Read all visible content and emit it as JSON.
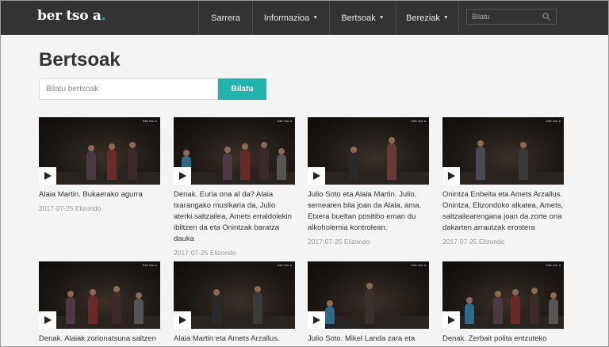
{
  "brand": {
    "logo_main": "ber tso a",
    "logo_dot": ".",
    "accent": "#1fb5ad"
  },
  "nav": {
    "items": [
      {
        "label": "Sarrera",
        "dropdown": false
      },
      {
        "label": "Informazioa",
        "dropdown": true
      },
      {
        "label": "Bertsoak",
        "dropdown": true
      },
      {
        "label": "Bereziak",
        "dropdown": true
      }
    ],
    "search_placeholder": "Bilatu",
    "search_icon": "search-icon",
    "caret_icon": "caret-down-icon"
  },
  "page": {
    "title": "Bertsoak"
  },
  "search": {
    "placeholder": "Bilatu bertsoak",
    "button_label": "Bilatu"
  },
  "videos": [
    {
      "title_lines": [
        "Alaia Martin. Bukaerako agurra"
      ],
      "date": "2017-07-25",
      "place": "Elizondo"
    },
    {
      "title_lines": [
        "Denak. Euria ona al da? Alaia",
        "txarangako musikaria da, Julio",
        "aterki saltzailea, Amets erraldoiekin",
        "ibiltzen da eta Onintzak baratza",
        "dauka"
      ],
      "date": "2017-07-25",
      "place": "Elizondo"
    },
    {
      "title_lines": [
        "Julio Soto eta Alaia Martin. Julio,",
        "semearen bila joan da Alaia, ama.",
        "Etxera bueltan positibo eman du",
        "alkoholemia kontrolean."
      ],
      "date": "2017-07-25",
      "place": "Elizondo"
    },
    {
      "title_lines": [
        "Onintza Enbeita eta Amets Arzallus.",
        "Onintza, Elizondoko alkatea, Amets,",
        "saltzailearengana joan da zorte ona",
        "dakarten arrautzak erostera"
      ],
      "date": "2017-07-25",
      "place": "Elizondo"
    },
    {
      "title_lines": [
        "Denak. Alaiak zorionatsuna saltzen"
      ],
      "date": "",
      "place": ""
    },
    {
      "title_lines": [
        "Alaia Martin eta Amets Arzallus."
      ],
      "date": "",
      "place": ""
    },
    {
      "title_lines": [
        "Julio Soto. Mikel Landa zara eta"
      ],
      "date": "",
      "place": ""
    },
    {
      "title_lines": [
        "Denak. Zerbait polita entzuteko"
      ],
      "date": "",
      "place": ""
    }
  ]
}
